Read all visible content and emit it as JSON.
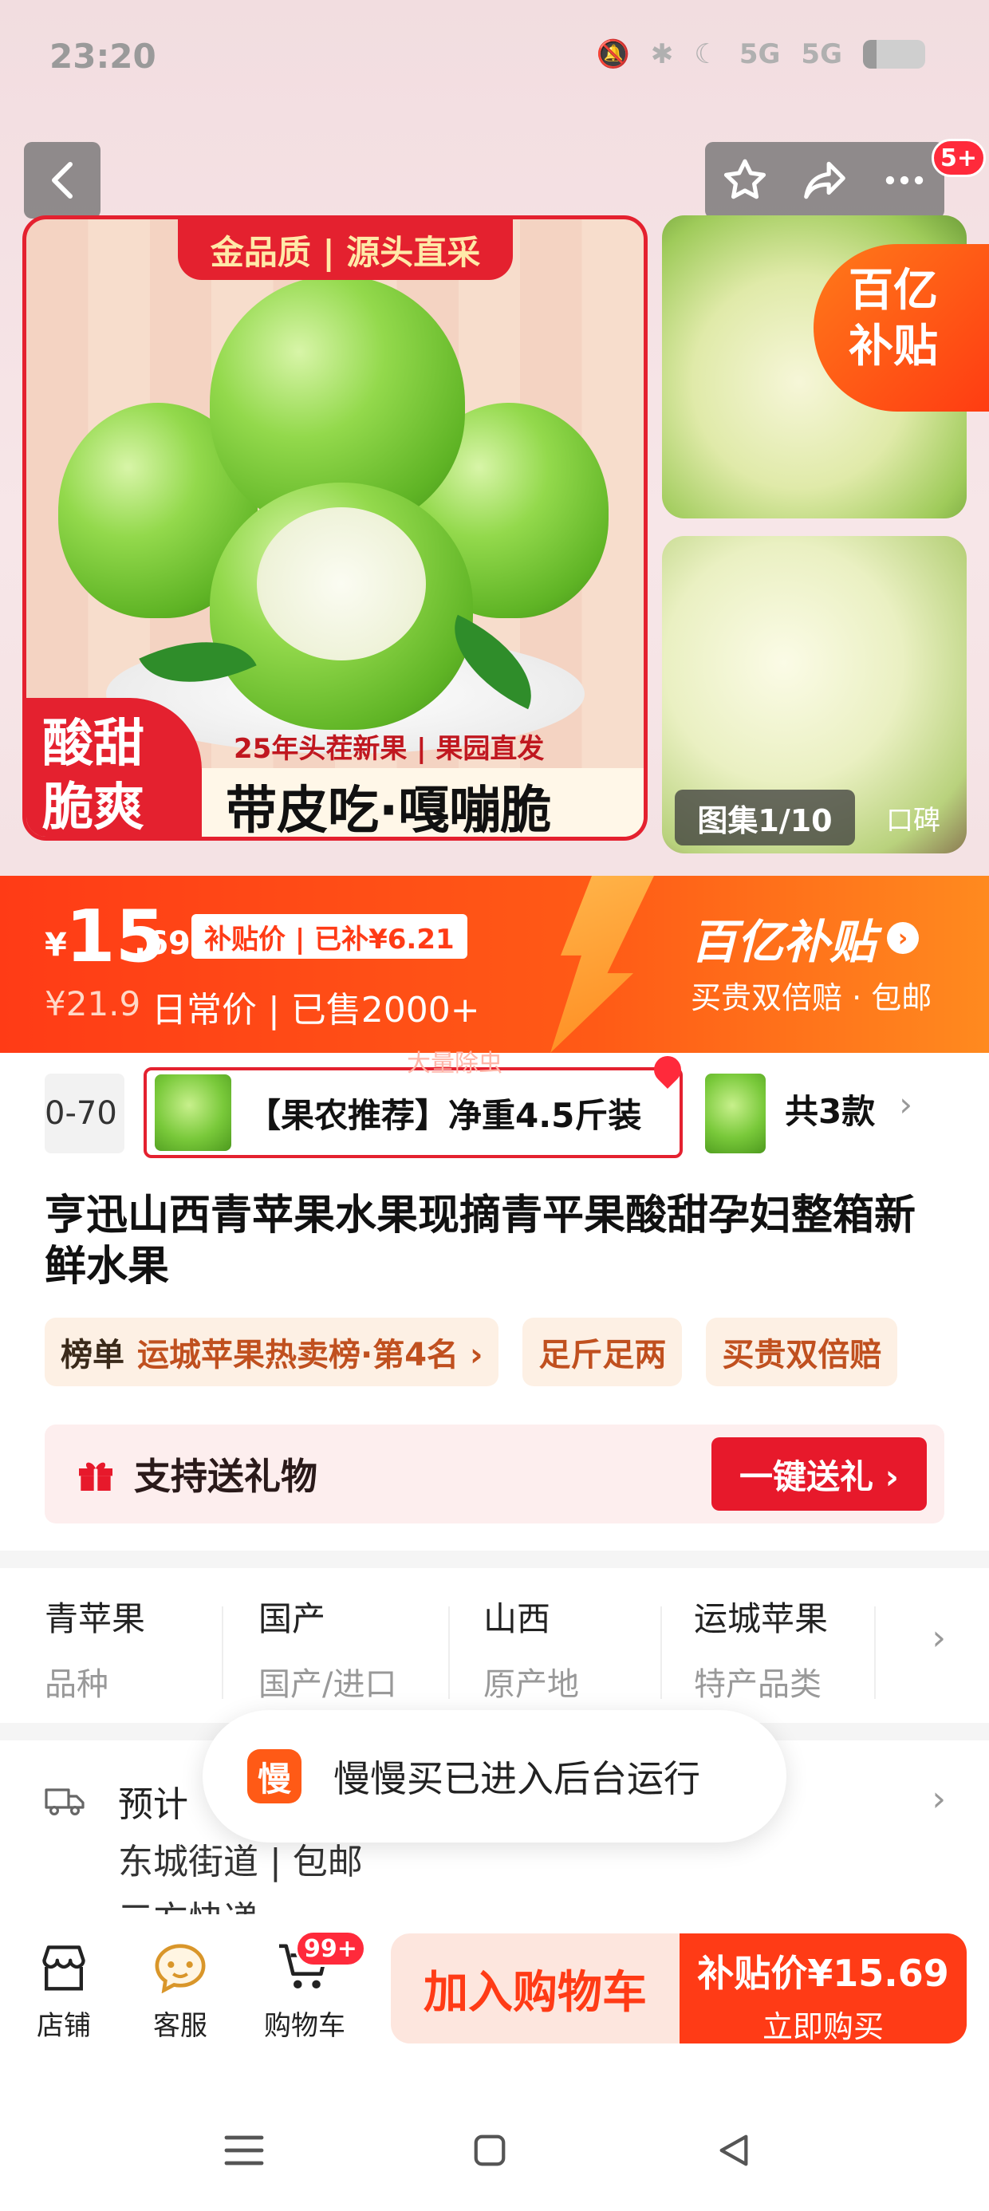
{
  "status_bar": {
    "time": "23:20",
    "network1": "5G",
    "network2": "5G"
  },
  "header": {
    "badge": "5+"
  },
  "gallery": {
    "banner_top": "金品质 | 源头直采",
    "corner_badge_line1": "酸甜",
    "corner_badge_line2": "脆爽",
    "subline": "25年头茬新果 | 果园直发",
    "slogan": "带皮吃·嘎嘣脆",
    "yi_badge_line1": "百亿",
    "yi_badge_line2": "补贴",
    "counter": "图集1/10",
    "review_tab": "口碑"
  },
  "price": {
    "currency": "¥",
    "integer": "15",
    "decimal": ".69",
    "tag": "补贴价 | 已补¥6.21",
    "original": "¥21.9",
    "sold": "日常价 | 已售2000+",
    "subsidy_title": "百亿补贴",
    "subsidy_perks": "买贵双倍赔 · 包邮"
  },
  "sku": {
    "prev_label": "0-70",
    "current_label": "【果农推荐】净重4.5斤装",
    "total": "共3款",
    "watermark": "大量除虫"
  },
  "product": {
    "title": "亨迅山西青苹果水果现摘青平果酸甜孕妇整箱新鲜水果",
    "tags": [
      {
        "key": "榜单",
        "value": "运城苹果热卖榜·第4名 ›"
      },
      {
        "value": "足斤足两"
      },
      {
        "value": "买贵双倍赔"
      }
    ]
  },
  "gift": {
    "label": "支持送礼物",
    "button": "一键送礼 ›"
  },
  "attributes": [
    {
      "value": "青苹果",
      "key": "品种"
    },
    {
      "value": "国产",
      "key": "国产/进口"
    },
    {
      "value": "山西",
      "key": "原产地"
    },
    {
      "value": "运城苹果",
      "key": "特产品类"
    }
  ],
  "shipping": {
    "line1": "预计",
    "line2": "东城街道 | 包邮",
    "line3": "三方快递"
  },
  "toast": {
    "icon": "慢",
    "message": "慢慢买已进入后台运行"
  },
  "bottom_bar": {
    "shop": "店铺",
    "service": "客服",
    "cart": "购物车",
    "cart_badge": "99+",
    "add_cart": "加入购物车",
    "buy_price": "补贴价¥15.69",
    "buy_label": "立即购买"
  },
  "colors": {
    "accent": "#ff3b16",
    "red": "#e4212f",
    "orange": "#ff8a1f"
  }
}
